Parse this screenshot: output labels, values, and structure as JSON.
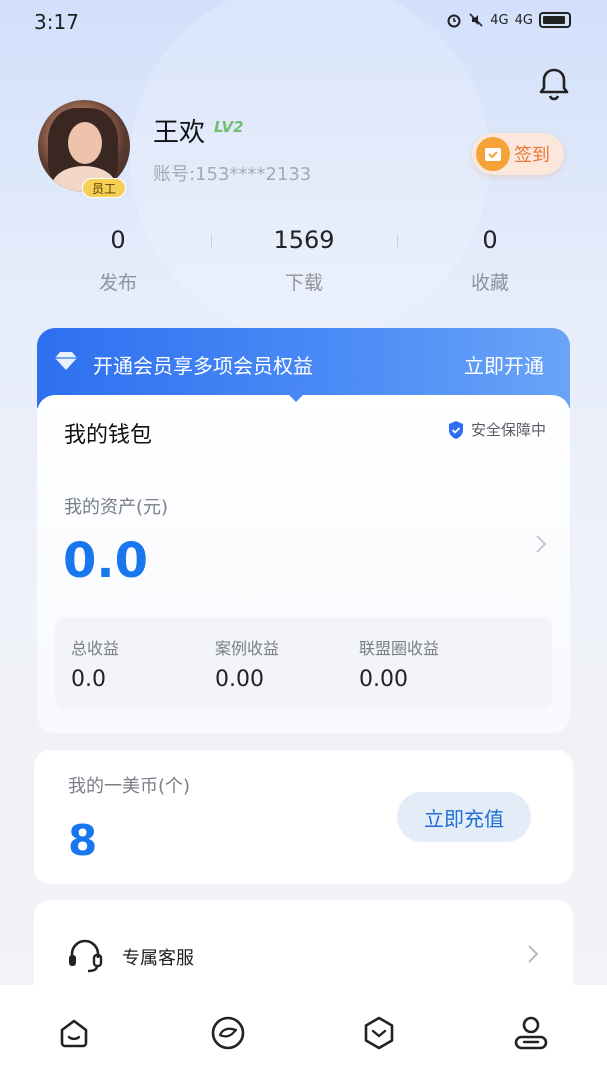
{
  "status_bar": {
    "time": "3:17",
    "icons": [
      "alarm-icon",
      "mute-icon",
      "signal-4g-icon",
      "signal-4g-icon",
      "battery-icon"
    ],
    "signal_1": "4G",
    "signal_2": "4G"
  },
  "profile": {
    "name": "王欢",
    "level": "LV2",
    "staff_badge": "员工",
    "account": "账号:153****2133",
    "checkin_label": "签到"
  },
  "stats": [
    {
      "value": "0",
      "label": "发布"
    },
    {
      "value": "1569",
      "label": "下载"
    },
    {
      "value": "0",
      "label": "收藏"
    }
  ],
  "membership": {
    "text": "开通会员享多项会员权益",
    "cta": "立即开通"
  },
  "wallet": {
    "title": "我的钱包",
    "secure_label": "安全保障中",
    "assets_label": "我的资产(元)",
    "assets_value": "0.0",
    "earnings": [
      {
        "label": "总收益",
        "value": "0.0"
      },
      {
        "label": "案例收益",
        "value": "0.00"
      },
      {
        "label": "联盟圈收益",
        "value": "0.00"
      }
    ]
  },
  "coins": {
    "label": "我的一美币(个)",
    "value": "8",
    "recharge": "立即充值"
  },
  "service": {
    "label": "专属客服"
  },
  "bottom_nav": [
    "home-icon",
    "discover-icon",
    "box-icon",
    "profile-icon"
  ],
  "colors": {
    "accent": "#1877ee",
    "banner": "#3a7bf2",
    "checkin": "#f5a338",
    "level": "#6ec06f"
  }
}
